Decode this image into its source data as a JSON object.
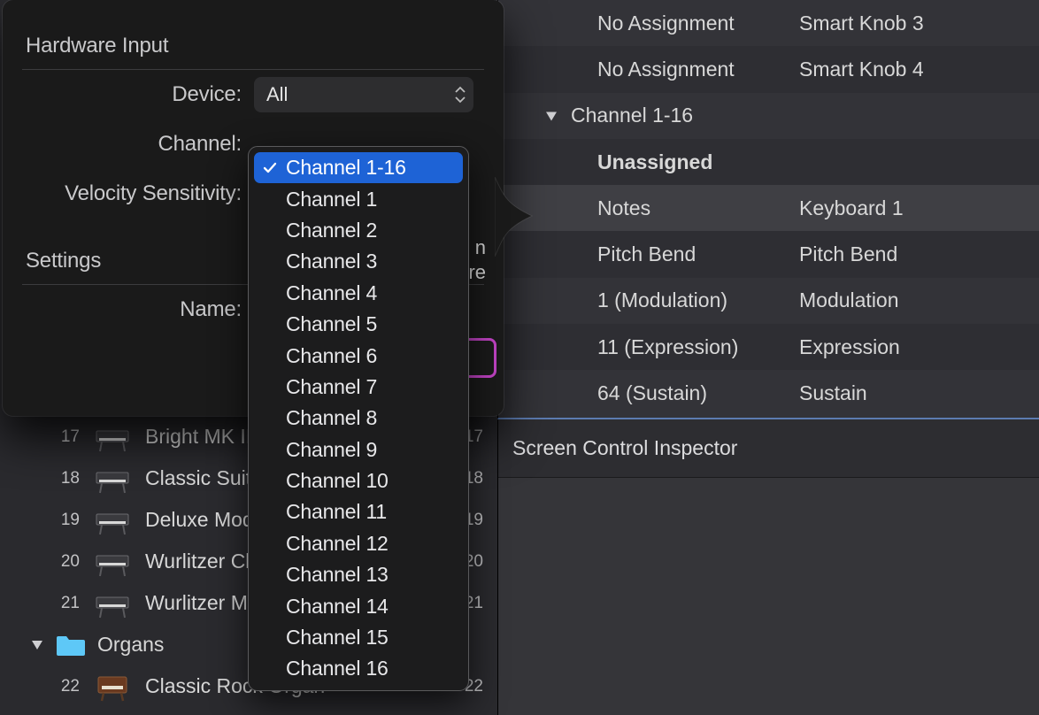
{
  "popover": {
    "hardware_input_header": "Hardware Input",
    "device_label": "Device:",
    "device_value": "All",
    "channel_label": "Channel:",
    "velocity_label": "Velocity Sensitivity:",
    "learn_peek_top": "n",
    "learn_peek_bot": "re",
    "settings_header": "Settings",
    "name_label": "Name:"
  },
  "channel_dropdown": {
    "selected_index": 0,
    "items": [
      "Channel 1-16",
      "Channel 1",
      "Channel 2",
      "Channel 3",
      "Channel 4",
      "Channel 5",
      "Channel 6",
      "Channel 7",
      "Channel 8",
      "Channel 9",
      "Channel 10",
      "Channel 11",
      "Channel 12",
      "Channel 13",
      "Channel 14",
      "Channel 15",
      "Channel 16"
    ]
  },
  "browser": {
    "items": [
      {
        "idx": "17",
        "label": "Bright MK II",
        "slot": "17",
        "type": "epiano"
      },
      {
        "idx": "18",
        "label": "Classic Suitcase",
        "slot": "18",
        "type": "epiano"
      },
      {
        "idx": "19",
        "label": "Deluxe Modern",
        "slot": "19",
        "type": "epiano"
      },
      {
        "idx": "20",
        "label": "Wurlitzer Classic",
        "slot": "20",
        "type": "wurli"
      },
      {
        "idx": "21",
        "label": "Wurlitzer Modern",
        "slot": "21",
        "type": "wurli"
      }
    ],
    "folder": {
      "label": "Organs"
    },
    "after": [
      {
        "idx": "22",
        "label": "Classic Rock Organ",
        "slot": "22",
        "type": "organ"
      }
    ]
  },
  "assignments": {
    "rows": [
      {
        "left": "No Assignment",
        "right": "Smart Knob 3",
        "alt": false
      },
      {
        "left": "No Assignment",
        "right": "Smart Knob 4",
        "alt": true
      },
      {
        "section": true,
        "left": "Channel 1-16",
        "right": "",
        "alt": false
      },
      {
        "left": "Unassigned",
        "right": "",
        "alt": true,
        "bold": true
      },
      {
        "left": "Notes",
        "right": "Keyboard 1",
        "alt": false,
        "highlight": true
      },
      {
        "left": "Pitch Bend",
        "right": "Pitch Bend",
        "alt": true
      },
      {
        "left": "1 (Modulation)",
        "right": "Modulation",
        "alt": false
      },
      {
        "left": "11 (Expression)",
        "right": "Expression",
        "alt": true
      },
      {
        "left": "64 (Sustain)",
        "right": "Sustain",
        "alt": false
      }
    ]
  },
  "sci": {
    "title": "Screen Control Inspector"
  }
}
